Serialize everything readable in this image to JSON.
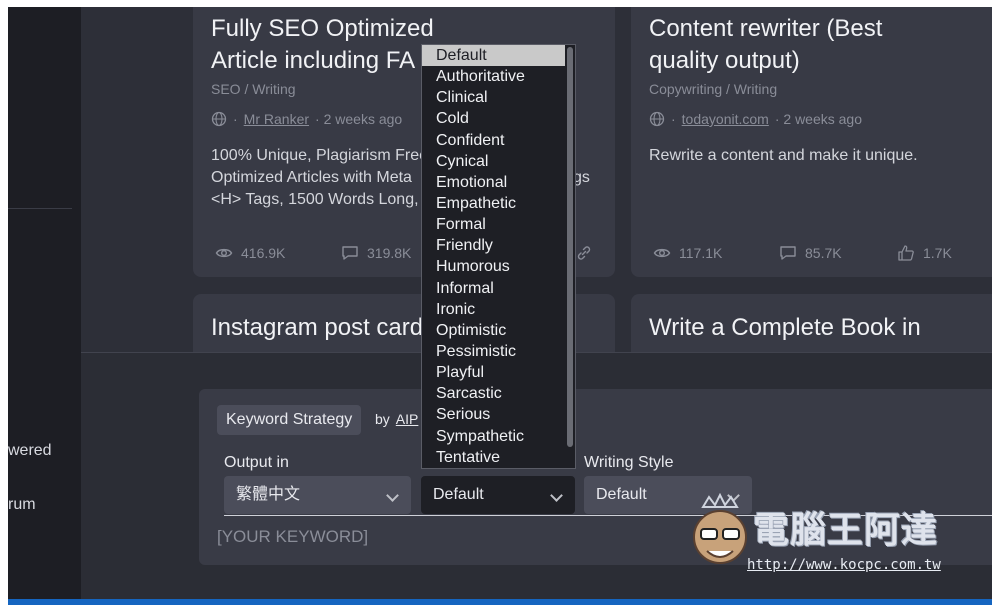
{
  "sidebar": {
    "item_1": "wered",
    "item_2": "rum"
  },
  "cards": [
    {
      "title_line1": "Fully SEO Optimized",
      "title_line2": "Article including FA",
      "category": "SEO / Writing",
      "author": "Mr Ranker",
      "time": "· 2 weeks ago",
      "desc_line1": "100% Unique, Plagiarism Free",
      "desc_line2": "Optimized Articles with Meta",
      "desc_line2_tail": "gs",
      "desc_line3": "<H> Tags, 1500 Words Long,",
      "views": "416.9K",
      "comments": "319.8K"
    },
    {
      "title_line1": "Content rewriter (Best",
      "title_line2": "quality output)",
      "category": "Copywriting / Writing",
      "author": "todayonit.com",
      "time": "· 2 weeks ago",
      "desc_line1": "Rewrite a content and make it unique.",
      "views": "117.1K",
      "comments": "85.7K",
      "likes": "1.7K"
    },
    {
      "title_line1": "Instagram post card"
    },
    {
      "title_line1": "Write a Complete Book in"
    }
  ],
  "form": {
    "keyword_strategy_button": "Keyword Strategy",
    "by_label": "by",
    "author": "AIP",
    "output_label": "Output in",
    "output_value": "繁體中文",
    "tone_value": "Default",
    "writing_style_label": "Writing Style",
    "writing_style_value": "Default",
    "keyword_placeholder": "[YOUR KEYWORD]"
  },
  "tone_options": [
    "Default",
    "Authoritative",
    "Clinical",
    "Cold",
    "Confident",
    "Cynical",
    "Emotional",
    "Empathetic",
    "Formal",
    "Friendly",
    "Humorous",
    "Informal",
    "Ironic",
    "Optimistic",
    "Pessimistic",
    "Playful",
    "Sarcastic",
    "Serious",
    "Sympathetic",
    "Tentative"
  ],
  "watermark": {
    "name": "電腦王阿達",
    "url": "http://www.kocpc.com.tw"
  }
}
